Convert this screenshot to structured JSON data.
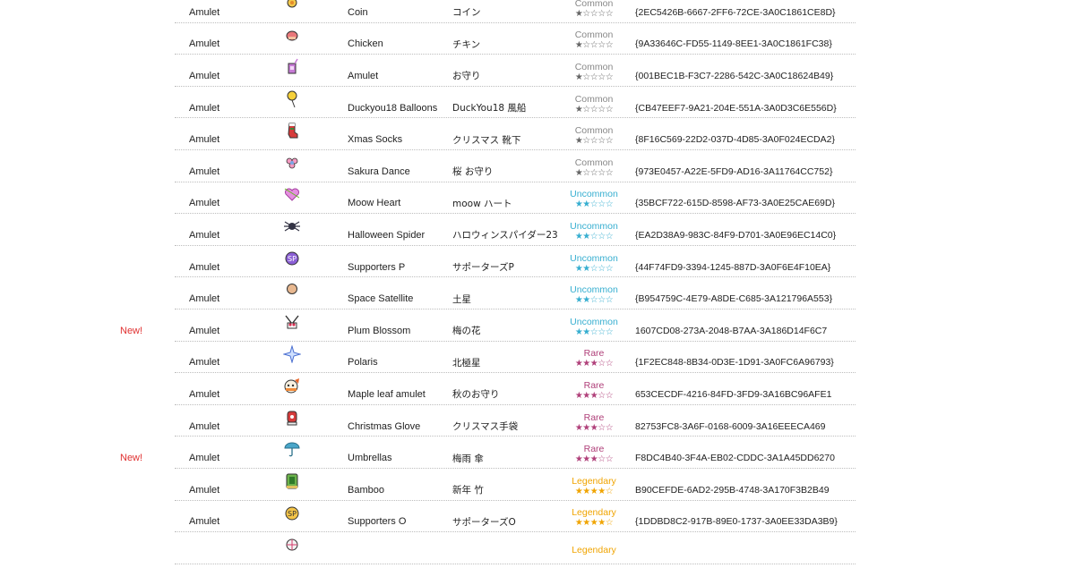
{
  "rows": [
    {
      "new": "",
      "type": "Amulet",
      "icon": "coin-icon",
      "name": "Coin",
      "jp": "コイン",
      "rarity": "Common",
      "stars": "★☆☆☆☆",
      "guid": "{2EC5426B-6667-2FF6-72CE-3A0C1861CE8D}"
    },
    {
      "new": "",
      "type": "Amulet",
      "icon": "chicken-icon",
      "name": "Chicken",
      "jp": "チキン",
      "rarity": "Common",
      "stars": "★☆☆☆☆",
      "guid": "{9A33646C-FD55-1149-8EE1-3A0C1861FC38}"
    },
    {
      "new": "",
      "type": "Amulet",
      "icon": "amulet-icon",
      "name": "Amulet",
      "jp": "お守り",
      "rarity": "Common",
      "stars": "★☆☆☆☆",
      "guid": "{001BEC1B-F3C7-2286-542C-3A0C18624B49}"
    },
    {
      "new": "",
      "type": "Amulet",
      "icon": "balloon-icon",
      "name": "Duckyou18 Balloons",
      "jp": "DuckYou18 風船",
      "rarity": "Common",
      "stars": "★☆☆☆☆",
      "guid": "{CB47EEF7-9A21-204E-551A-3A0D3C6E556D}"
    },
    {
      "new": "",
      "type": "Amulet",
      "icon": "sock-icon",
      "name": "Xmas Socks",
      "jp": "クリスマス 靴下",
      "rarity": "Common",
      "stars": "★☆☆☆☆",
      "guid": "{8F16C569-22D2-037D-4D85-3A0F024ECDA2}"
    },
    {
      "new": "",
      "type": "Amulet",
      "icon": "sakura-icon",
      "name": "Sakura Dance",
      "jp": "桜 お守り",
      "rarity": "Common",
      "stars": "★☆☆☆☆",
      "guid": "{973E0457-A22E-5FD9-AD16-3A11764CC752}"
    },
    {
      "new": "",
      "type": "Amulet",
      "icon": "heart-icon",
      "name": "Moow Heart",
      "jp": "moow ハート",
      "rarity": "Uncommon",
      "stars": "★★☆☆☆",
      "guid": "{35BCF722-615D-8598-AF73-3A0E25CAE69D}"
    },
    {
      "new": "",
      "type": "Amulet",
      "icon": "spider-icon",
      "name": "Halloween Spider",
      "jp": "ハロウィンスパイダー23",
      "rarity": "Uncommon",
      "stars": "★★☆☆☆",
      "guid": "{EA2D38A9-983C-84F9-D701-3A0E96EC14C0}"
    },
    {
      "new": "",
      "type": "Amulet",
      "icon": "supporters-p-icon",
      "name": "Supporters P",
      "jp": "サポーターズP",
      "rarity": "Uncommon",
      "stars": "★★☆☆☆",
      "guid": "{44F74FD9-3394-1245-887D-3A0F6E4F10EA}"
    },
    {
      "new": "",
      "type": "Amulet",
      "icon": "satellite-icon",
      "name": "Space Satellite",
      "jp": "土星",
      "rarity": "Uncommon",
      "stars": "★★☆☆☆",
      "guid": "{B954759C-4E79-A8DE-C685-3A121796A553}"
    },
    {
      "new": "New!",
      "type": "Amulet",
      "icon": "plum-blossom-icon",
      "name": "Plum Blossom",
      "jp": "梅の花",
      "rarity": "Uncommon",
      "stars": "★★☆☆☆",
      "guid": "1607CD08-273A-2048-B7AA-3A186D14F6C7"
    },
    {
      "new": "",
      "type": "Amulet",
      "icon": "polaris-star-icon",
      "name": "Polaris",
      "jp": "北極星",
      "rarity": "Rare",
      "stars": "★★★☆☆",
      "guid": "{1F2EC848-8B34-0D3E-1D91-3A0FC6A96793}"
    },
    {
      "new": "",
      "type": "Amulet",
      "icon": "maple-leaf-icon",
      "name": "Maple leaf amulet",
      "jp": "秋のお守り",
      "rarity": "Rare",
      "stars": "★★★☆☆",
      "guid": "653CECDF-4216-84FD-3FD9-3A16BC96AFE1"
    },
    {
      "new": "",
      "type": "Amulet",
      "icon": "glove-icon",
      "name": "Christmas Glove",
      "jp": "クリスマス手袋",
      "rarity": "Rare",
      "stars": "★★★☆☆",
      "guid": "82753FC8-3A6F-0168-6009-3A16EEECA469"
    },
    {
      "new": "New!",
      "type": "Amulet",
      "icon": "umbrella-icon",
      "name": "Umbrellas",
      "jp": "梅雨 傘",
      "rarity": "Rare",
      "stars": "★★★☆☆",
      "guid": "F8DC4B40-3F4A-EB02-CDDC-3A1A45DD6270"
    },
    {
      "new": "",
      "type": "Amulet",
      "icon": "bamboo-icon",
      "name": "Bamboo",
      "jp": "新年 竹",
      "rarity": "Legendary",
      "stars": "★★★★☆",
      "guid": "B90CEFDE-6AD2-295B-4748-3A170F3B2B49"
    },
    {
      "new": "",
      "type": "Amulet",
      "icon": "supporters-o-icon",
      "name": "Supporters O",
      "jp": "サポーターズO",
      "rarity": "Legendary",
      "stars": "★★★★☆",
      "guid": "{1DDBD8C2-917B-89E0-1737-3A0EE33DA3B9}"
    },
    {
      "new": "",
      "type": "",
      "icon": "ball-icon",
      "name": "",
      "jp": "",
      "rarity": "Legendary",
      "stars": "",
      "guid": ""
    }
  ]
}
